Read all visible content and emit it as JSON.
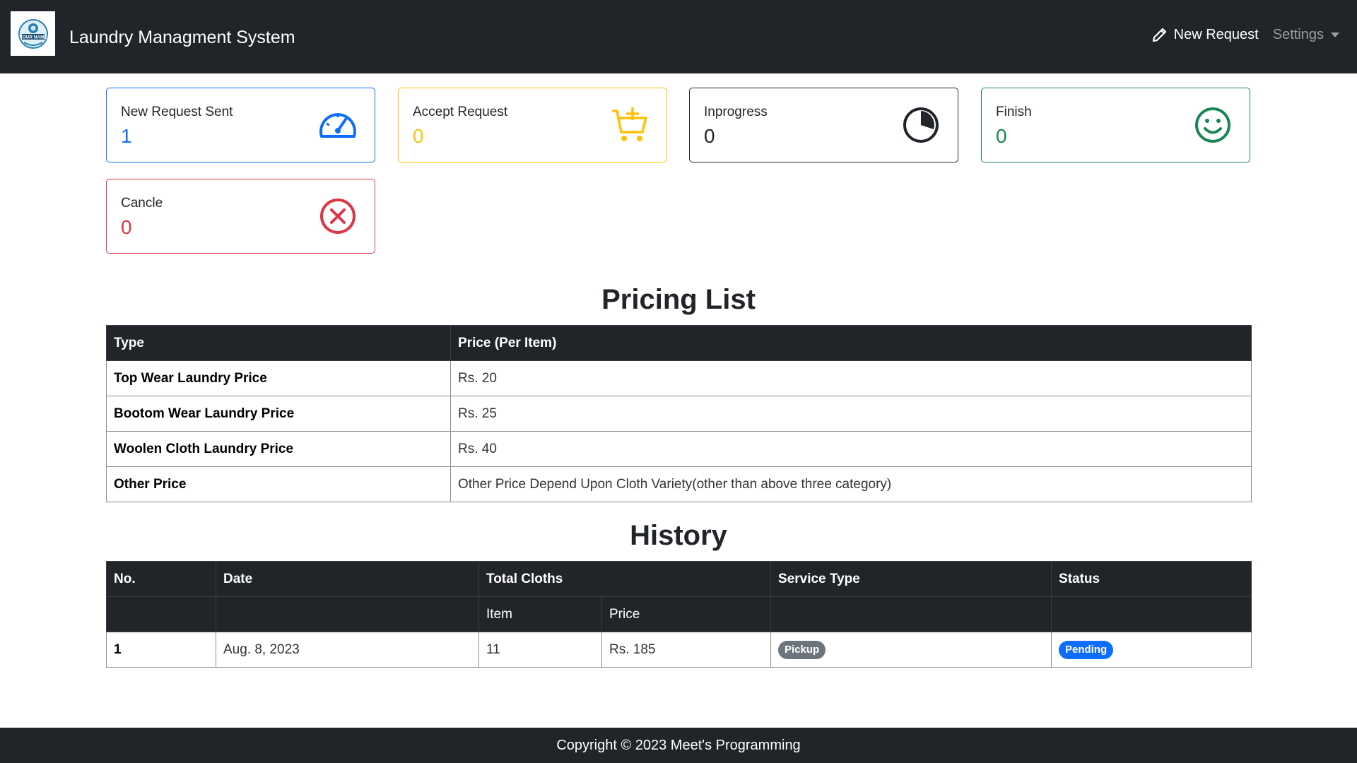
{
  "navbar": {
    "logo_text": "YOUR NAME",
    "title": "Laundry Managment System",
    "new_request": "New Request",
    "settings": "Settings"
  },
  "cards": [
    {
      "label": "New Request Sent",
      "value": "1",
      "color": "#0d6efd",
      "icon": "speedometer-icon"
    },
    {
      "label": "Accept Request",
      "value": "0",
      "color": "#ffc107",
      "icon": "cart-plus-icon"
    },
    {
      "label": "Inprogress",
      "value": "0",
      "color": "#212529",
      "icon": "pie-progress-icon"
    },
    {
      "label": "Finish",
      "value": "0",
      "color": "#198754",
      "icon": "smile-icon"
    },
    {
      "label": "Cancle",
      "value": "0",
      "color": "#dc3545",
      "icon": "x-circle-icon"
    }
  ],
  "pricing": {
    "title": "Pricing List",
    "headers": [
      "Type",
      "Price (Per Item)"
    ],
    "rows": [
      {
        "type": "Top Wear Laundry Price",
        "price": "Rs. 20"
      },
      {
        "type": "Bootom Wear Laundry Price",
        "price": "Rs. 25"
      },
      {
        "type": "Woolen Cloth Laundry Price",
        "price": "Rs. 40"
      },
      {
        "type": "Other Price",
        "price": "Other Price Depend Upon Cloth Variety(other than above three category)"
      }
    ]
  },
  "history": {
    "title": "History",
    "headers": {
      "no": "No.",
      "date": "Date",
      "total": "Total Cloths",
      "item": "Item",
      "price": "Price",
      "service": "Service Type",
      "status": "Status"
    },
    "rows": [
      {
        "no": "1",
        "date": "Aug. 8, 2023",
        "item": "11",
        "price": "Rs. 185",
        "service": "Pickup",
        "status": "Pending"
      }
    ]
  },
  "colors": {
    "navbar": "#212529",
    "pickup_badge": "#6c757d",
    "pending_badge": "#0d6efd"
  },
  "footer": "Copyright © 2023 Meet's Programming"
}
